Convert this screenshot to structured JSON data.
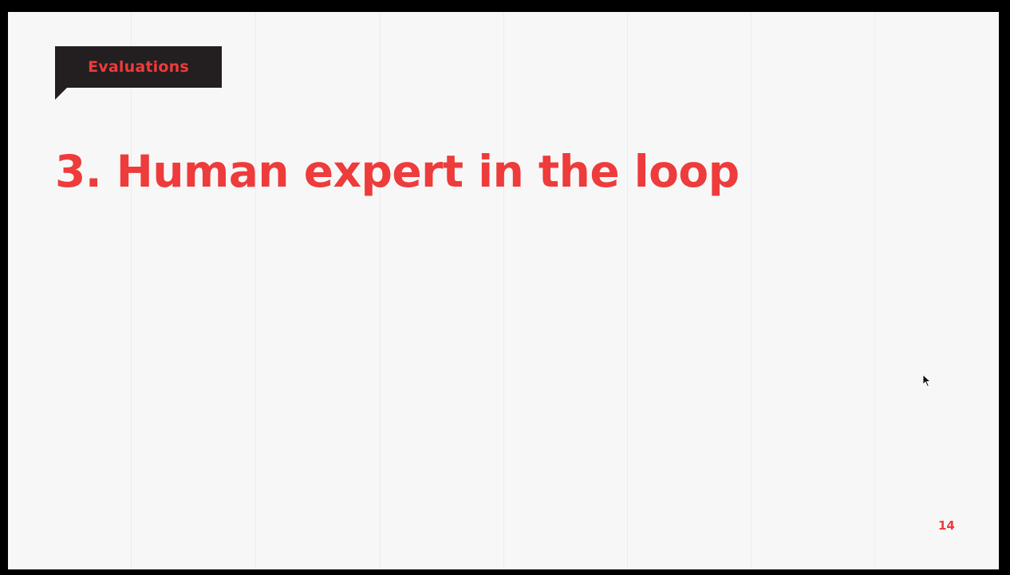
{
  "slide": {
    "section_tag": "Evaluations",
    "title": "3. Human expert in the loop",
    "page_number": "14"
  },
  "colors": {
    "accent": "#ee3b3b",
    "tag_background": "#231f20",
    "slide_background": "#f7f7f7",
    "frame_background": "#000000"
  },
  "icons": {
    "cursor": "mouse-pointer-arrow"
  }
}
